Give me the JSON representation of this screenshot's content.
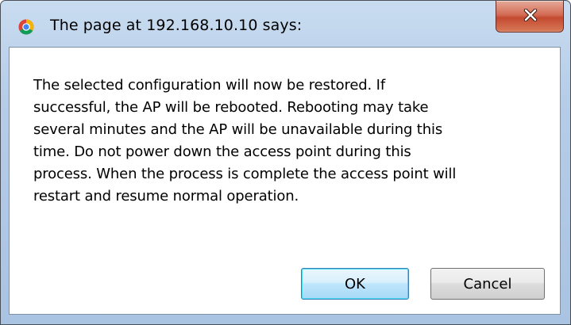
{
  "dialog": {
    "title": "The page at 192.168.10.10 says:",
    "message": "The selected configuration will now be restored.  If\nsuccessful, the AP will be rebooted.  Rebooting may take\nseveral minutes and the AP will be unavailable during this\ntime.  Do not power down the access point during  this\nprocess.  When the process is complete the access point will\nrestart and resume normal operation.",
    "ok_label": "OK",
    "cancel_label": "Cancel"
  },
  "icons": {
    "app": "chrome-icon",
    "close": "close-icon"
  },
  "colors": {
    "titlebar": "#b6cde8",
    "close_button": "#c44a30",
    "ok_focus_border": "#3c7fb1"
  }
}
